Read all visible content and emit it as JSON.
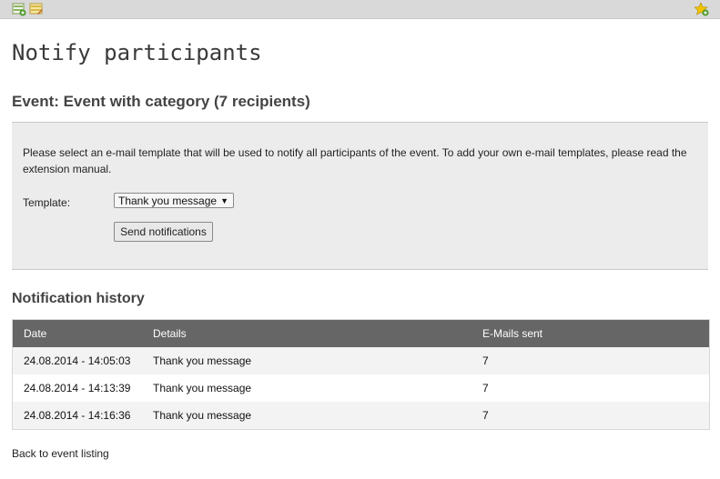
{
  "toolbar": {
    "icons": [
      "new-record-icon",
      "edit-icon",
      "bookmark-icon"
    ]
  },
  "page": {
    "title": "Notify participants",
    "event_heading": "Event: Event with category (7 recipients)"
  },
  "form": {
    "description": "Please select an e-mail template that will be used to notify all participants of the event. To add your own e-mail templates, please read the extension manual.",
    "template_label": "Template:",
    "template_selected": "Thank you message",
    "send_button_label": "Send notifications"
  },
  "history": {
    "heading": "Notification history",
    "columns": [
      "Date",
      "Details",
      "E-Mails sent"
    ],
    "rows": [
      {
        "date": "24.08.2014 - 14:05:03",
        "details": "Thank you message",
        "sent": "7"
      },
      {
        "date": "24.08.2014 - 14:13:39",
        "details": "Thank you message",
        "sent": "7"
      },
      {
        "date": "24.08.2014 - 14:16:36",
        "details": "Thank you message",
        "sent": "7"
      }
    ]
  },
  "footer": {
    "back_link": "Back to event listing"
  },
  "colors": {
    "table_header": "#666666",
    "panel_bg": "#ececec",
    "toolbar_bg": "#d9d9d9",
    "accent_green": "#5aa02c",
    "accent_yellow": "#f2c200"
  }
}
